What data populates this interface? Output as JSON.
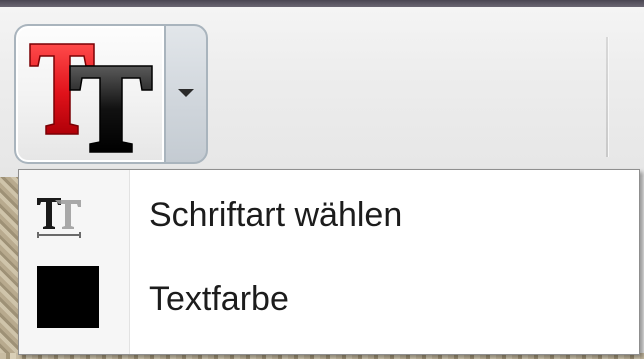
{
  "toolbar": {
    "text_style_button": {
      "icon": "text-color-font-icon",
      "glyphs": "TT"
    },
    "dropdown_arrow": {
      "icon": "chevron-down-icon"
    }
  },
  "menu": {
    "items": [
      {
        "label": "Schriftart wählen",
        "icon": "font-style-icon"
      },
      {
        "label": "Textfarbe",
        "icon": "color-swatch-icon",
        "color": "#000000"
      }
    ]
  },
  "colors": {
    "red_t": "#e0121a",
    "black_t": "#111111",
    "menu_bg": "#ffffff",
    "button_border": "#a9b4bd"
  }
}
